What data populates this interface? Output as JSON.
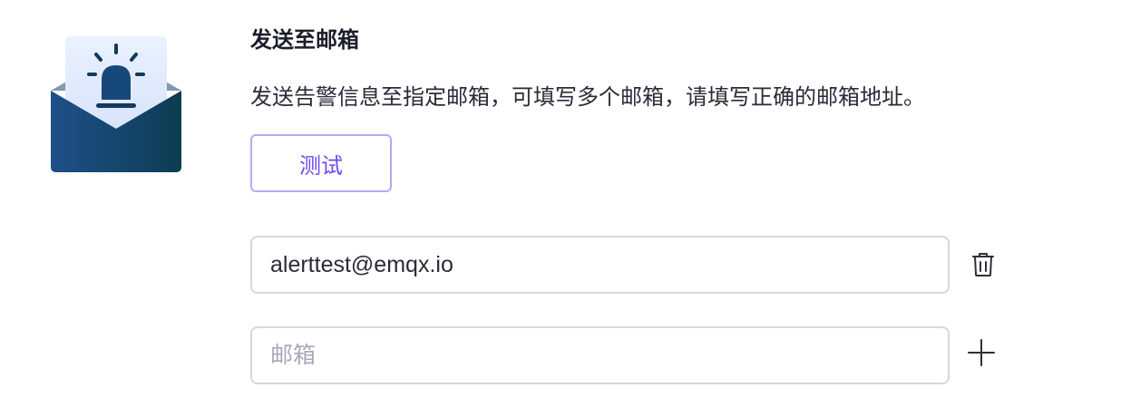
{
  "notification": {
    "title": "发送至邮箱",
    "description": "发送告警信息至指定邮箱，可填写多个邮箱，请填写正确的邮箱地址。",
    "test_button_label": "测试"
  },
  "email_fields": [
    {
      "value": "alerttest@emqx.io",
      "action_icon": "trash-icon"
    },
    {
      "value": "",
      "placeholder": "邮箱",
      "action_icon": "plus-icon"
    }
  ],
  "colors": {
    "accent": "#6f49ef",
    "button_border": "#b9a8f3",
    "envelope_dark": "#0e3e57",
    "envelope_light": "#1e4f86",
    "paper": "#e6efff"
  }
}
